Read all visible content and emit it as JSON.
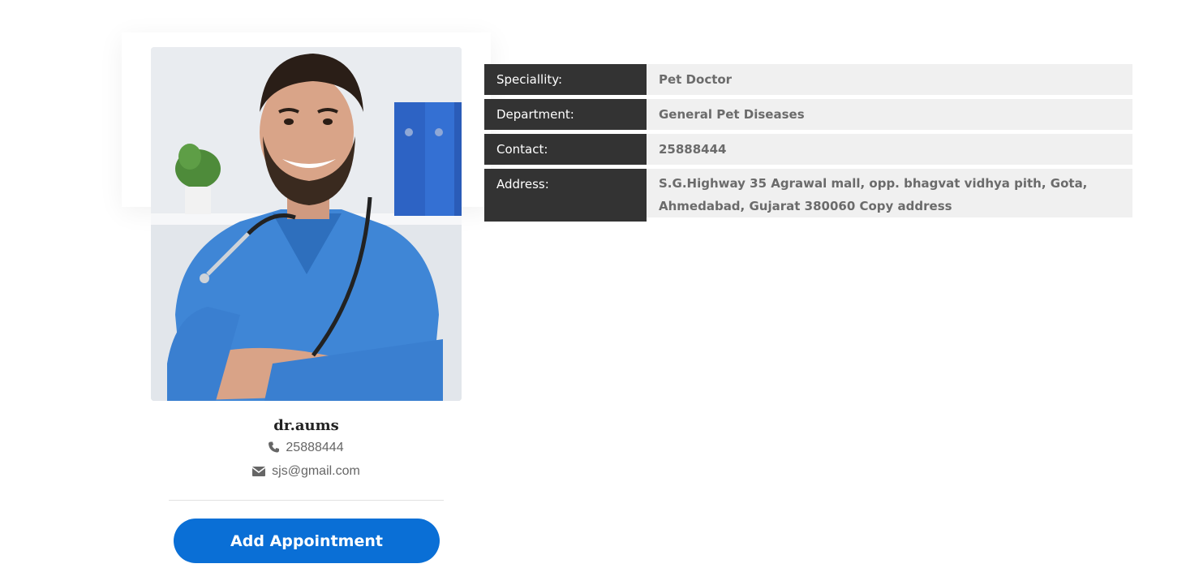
{
  "doctor": {
    "name": "dr.aums",
    "phone": "25888444",
    "email": "sjs@gmail.com"
  },
  "actions": {
    "add_appointment_label": "Add Appointment"
  },
  "details": {
    "rows": [
      {
        "label": "Speciallity:",
        "value": "Pet Doctor"
      },
      {
        "label": "Department:",
        "value": "General Pet Diseases"
      },
      {
        "label": "Contact:",
        "value": "25888444"
      },
      {
        "label": "Address:",
        "value": "S.G.Highway 35 Agrawal mall, opp. bhagvat vidhya pith, Gota, Ahmedabad, Gujarat 380060 Copy address"
      }
    ]
  },
  "colors": {
    "accent_button": "#0a6fd6",
    "label_background": "#333333",
    "value_background": "#f0f0f0"
  },
  "icons": {
    "phone": "phone-icon",
    "email": "envelope-icon"
  }
}
